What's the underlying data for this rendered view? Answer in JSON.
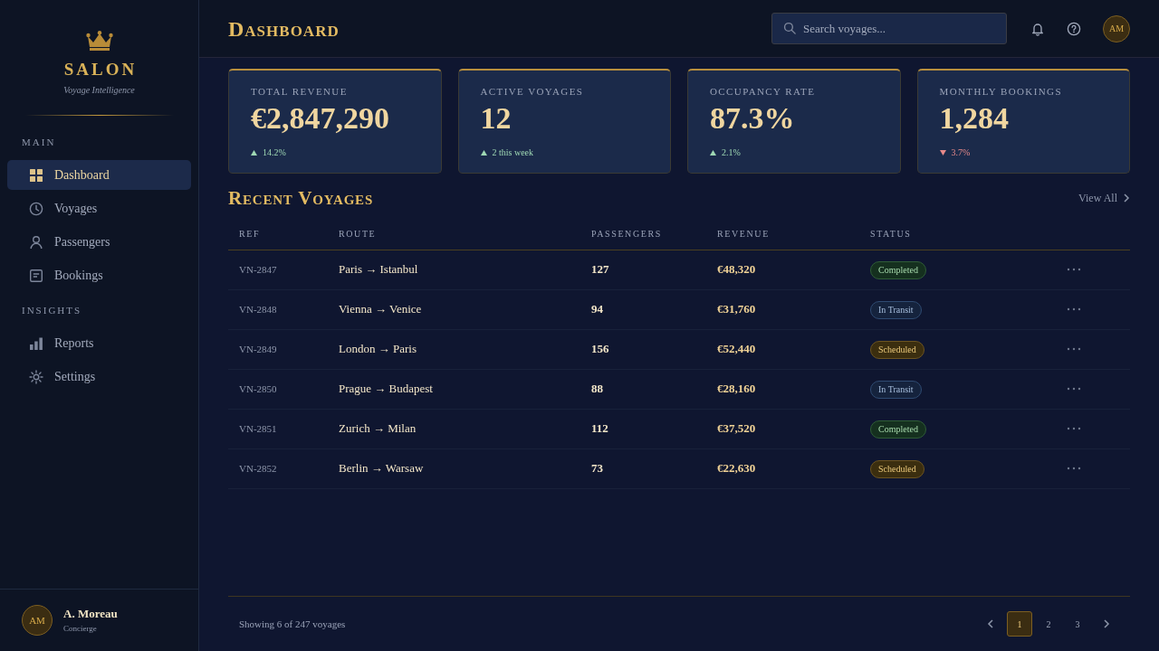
{
  "sidebar": {
    "brand": {
      "name": "SALON",
      "tagline": "Voyage Intelligence"
    },
    "sections": [
      {
        "title": "MAIN",
        "items": [
          {
            "label": "Dashboard",
            "selected": true
          },
          {
            "label": "Voyages",
            "selected": false
          },
          {
            "label": "Passengers",
            "selected": false
          },
          {
            "label": "Bookings",
            "selected": false
          }
        ]
      },
      {
        "title": "INSIGHTS",
        "items": [
          {
            "label": "Reports",
            "selected": false
          },
          {
            "label": "Settings",
            "selected": false
          }
        ]
      }
    ],
    "user": {
      "initials": "AM",
      "name": "A. Moreau",
      "role": "Concierge"
    }
  },
  "header": {
    "title": "Dashboard",
    "search": {
      "placeholder": "Search voyages..."
    },
    "avatar": "AM"
  },
  "stats": [
    {
      "label": "TOTAL REVENUE",
      "value": "€2,847,290",
      "change": "14.2%",
      "kind": "up"
    },
    {
      "label": "ACTIVE VOYAGES",
      "value": "12",
      "change": "2 this week",
      "kind": "up"
    },
    {
      "label": "OCCUPANCY RATE",
      "value": "87.3%",
      "change": "2.1%",
      "kind": "up"
    },
    {
      "label": "MONTHLY BOOKINGS",
      "value": "1,284",
      "change": "3.7%",
      "kind": "down"
    }
  ],
  "voyages": {
    "title": "Recent Voyages",
    "view_all": "View All",
    "columns": [
      "REF",
      "ROUTE",
      "PASSENGERS",
      "REVENUE",
      "STATUS"
    ],
    "rows": [
      {
        "ref": "VN-2847",
        "route": "Paris → Istanbul",
        "passengers": "127",
        "revenue": "€48,320",
        "status": {
          "label": "Completed",
          "kind": "completed"
        }
      },
      {
        "ref": "VN-2848",
        "route": "Vienna → Venice",
        "passengers": "94",
        "revenue": "€31,760",
        "status": {
          "label": "In Transit",
          "kind": "transit"
        }
      },
      {
        "ref": "VN-2849",
        "route": "London → Paris",
        "passengers": "156",
        "revenue": "€52,440",
        "status": {
          "label": "Scheduled",
          "kind": "scheduled"
        }
      },
      {
        "ref": "VN-2850",
        "route": "Prague → Budapest",
        "passengers": "88",
        "revenue": "€28,160",
        "status": {
          "label": "In Transit",
          "kind": "transit"
        }
      },
      {
        "ref": "VN-2851",
        "route": "Zurich → Milan",
        "passengers": "112",
        "revenue": "€37,520",
        "status": {
          "label": "Completed",
          "kind": "completed"
        }
      },
      {
        "ref": "VN-2852",
        "route": "Berlin → Warsaw",
        "passengers": "73",
        "revenue": "€22,630",
        "status": {
          "label": "Scheduled",
          "kind": "scheduled"
        }
      }
    ],
    "summary": "Showing 6 of 247 voyages",
    "pages": [
      {
        "label": "1",
        "selected": true
      },
      {
        "label": "2",
        "selected": false
      },
      {
        "label": "3",
        "selected": false
      }
    ]
  }
}
